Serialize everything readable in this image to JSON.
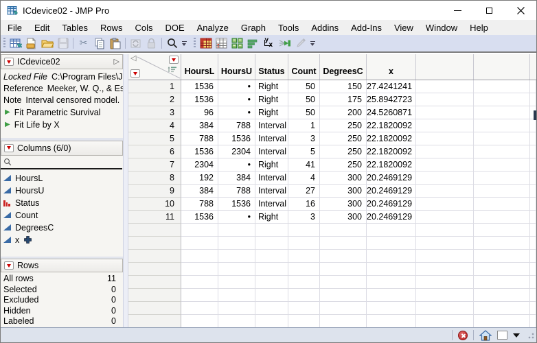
{
  "window": {
    "title": "ICdevice02 - JMP Pro"
  },
  "menu_items": [
    "File",
    "Edit",
    "Tables",
    "Rows",
    "Cols",
    "DOE",
    "Analyze",
    "Graph",
    "Tools",
    "Addins",
    "Add-Ins",
    "View",
    "Window",
    "Help"
  ],
  "glyphs": {
    "cut": "✂",
    "collapse": "◁",
    "disclosure": "▷",
    "script_play": "▶",
    "fit_y": "y",
    "fit_x": "x"
  },
  "table_panel": {
    "title": "ICdevice02",
    "properties": [
      {
        "label": "Locked File",
        "value": "C:\\Program Files\\JM"
      },
      {
        "label": "Reference",
        "value": "Meeker, W. Q., & Esc"
      },
      {
        "label": "Note",
        "value": "Interval censored model."
      }
    ],
    "scripts": [
      "Fit Parametric Survival",
      "Fit Life by X"
    ]
  },
  "columns_panel": {
    "title": "Columns (6/0)",
    "search_placeholder": "",
    "columns": [
      {
        "name": "HoursL",
        "type": "continuous"
      },
      {
        "name": "HoursU",
        "type": "continuous"
      },
      {
        "name": "Status",
        "type": "nominal"
      },
      {
        "name": "Count",
        "type": "continuous"
      },
      {
        "name": "DegreesC",
        "type": "continuous"
      },
      {
        "name": "x",
        "type": "continuous-formula"
      }
    ]
  },
  "rows_panel": {
    "title": "Rows",
    "stats": [
      {
        "label": "All rows",
        "value": "11"
      },
      {
        "label": "Selected",
        "value": "0"
      },
      {
        "label": "Excluded",
        "value": "0"
      },
      {
        "label": "Hidden",
        "value": "0"
      },
      {
        "label": "Labeled",
        "value": "0"
      }
    ]
  },
  "data_table": {
    "headers": [
      "HoursL",
      "HoursU",
      "Status",
      "Count",
      "DegreesC",
      "x"
    ],
    "rows": [
      {
        "n": "1",
        "HoursL": "1536",
        "HoursU": "•",
        "Status": "Right",
        "Count": "50",
        "DegreesC": "150",
        "x": "27.4241241"
      },
      {
        "n": "2",
        "HoursL": "1536",
        "HoursU": "•",
        "Status": "Right",
        "Count": "50",
        "DegreesC": "175",
        "x": "25.8942723"
      },
      {
        "n": "3",
        "HoursL": "96",
        "HoursU": "•",
        "Status": "Right",
        "Count": "50",
        "DegreesC": "200",
        "x": "24.5260871"
      },
      {
        "n": "4",
        "HoursL": "384",
        "HoursU": "788",
        "Status": "Interval",
        "Count": "1",
        "DegreesC": "250",
        "x": "22.1820092"
      },
      {
        "n": "5",
        "HoursL": "788",
        "HoursU": "1536",
        "Status": "Interval",
        "Count": "3",
        "DegreesC": "250",
        "x": "22.1820092"
      },
      {
        "n": "6",
        "HoursL": "1536",
        "HoursU": "2304",
        "Status": "Interval",
        "Count": "5",
        "DegreesC": "250",
        "x": "22.1820092"
      },
      {
        "n": "7",
        "HoursL": "2304",
        "HoursU": "•",
        "Status": "Right",
        "Count": "41",
        "DegreesC": "250",
        "x": "22.1820092"
      },
      {
        "n": "8",
        "HoursL": "192",
        "HoursU": "384",
        "Status": "Interval",
        "Count": "4",
        "DegreesC": "300",
        "x": "20.2469129"
      },
      {
        "n": "9",
        "HoursL": "384",
        "HoursU": "788",
        "Status": "Interval",
        "Count": "27",
        "DegreesC": "300",
        "x": "20.2469129"
      },
      {
        "n": "10",
        "HoursL": "788",
        "HoursU": "1536",
        "Status": "Interval",
        "Count": "16",
        "DegreesC": "300",
        "x": "20.2469129"
      },
      {
        "n": "11",
        "HoursL": "1536",
        "HoursU": "•",
        "Status": "Right",
        "Count": "3",
        "DegreesC": "300",
        "x": "20.2469129"
      }
    ],
    "empty_row_count": 9
  },
  "colors": {
    "red_triangle": "#cc0000",
    "script_green": "#3f9e46",
    "continuous_blue": "#3a6ba6",
    "nominal_red": "#cc2222",
    "toolbar_bg": "#d8def0",
    "statusbar_bg": "#dde3ed"
  }
}
